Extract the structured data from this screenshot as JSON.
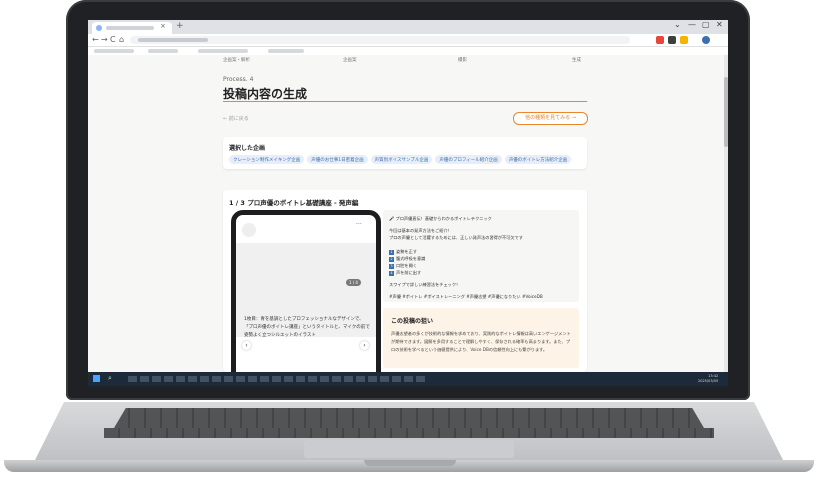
{
  "browser": {
    "new_tab": "+",
    "tab_close": "×",
    "window_controls": [
      "⌄",
      "—",
      "▢",
      "✕"
    ],
    "nav_icons": [
      "←",
      "→",
      "C",
      "⌂"
    ]
  },
  "steps": [
    "企画案・解析",
    "企画案",
    "撮影",
    "生成"
  ],
  "process_label": "Process. 4",
  "page_title": "投稿内容の生成",
  "back_link": "← 前に戻る",
  "other_plans_button": "他の種類を見てみる →",
  "selected": {
    "heading": "選択した企画",
    "chips": [
      "クレーション制作メイキング企画",
      "声優のお仕事1日密着企画",
      "声質別ボイスサンプル企画",
      "声優のプロフィール紹介企画",
      "声優のボイトレ方法紹介企画"
    ]
  },
  "post": {
    "heading": "1 / 3  プロ声優のボイトレ基礎講座 - 発声編",
    "phone": {
      "menu": "···",
      "counter": "1 / 4",
      "description": "1枚目：青を基調としたプロフェッショナルなデザインで、「プロ声優のボイトレ講座」というタイトルと、マイクの前で姿勢よく立つシルエットのイラスト",
      "prev": "‹",
      "next": "›"
    },
    "caption": {
      "line1": "🎤 プロ声優直伝！基礎からわかるボイトレテクニック",
      "line2": "今回は基本の発声方法をご紹介！",
      "line3": "プロの声優として活躍するためには、正しい発声法の習得が不可欠です",
      "items": [
        "姿勢を正す",
        "腹式呼吸を意識",
        "口腔を開く",
        "声を前に出す"
      ],
      "line4": "スワイプで詳しい練習法をチェック！",
      "hashtags": "#声優 #ボイトレ #ボイストレーニング #声優志望 #声優になりたい #VoiceDB"
    },
    "aim": {
      "heading": "この投稿の狙い",
      "text": "声優志望者の多くが技術的な情報を求めており、実践的なボイトレ情報は高いエンゲージメントが期待できます。図解を多用することで理解しやすく、保存される確率も高まります。また、プロの技術を学べるという価値提供により、Voice DBの信頼性向上にも繋がります。"
    }
  },
  "taskbar": {
    "search_icon": "⌕",
    "time": "13:42",
    "date": "2025/03/05"
  },
  "colors": {
    "accent": "#e8872f",
    "chip_text": "#3b6fb0",
    "chip_bg": "#e7eef8"
  }
}
